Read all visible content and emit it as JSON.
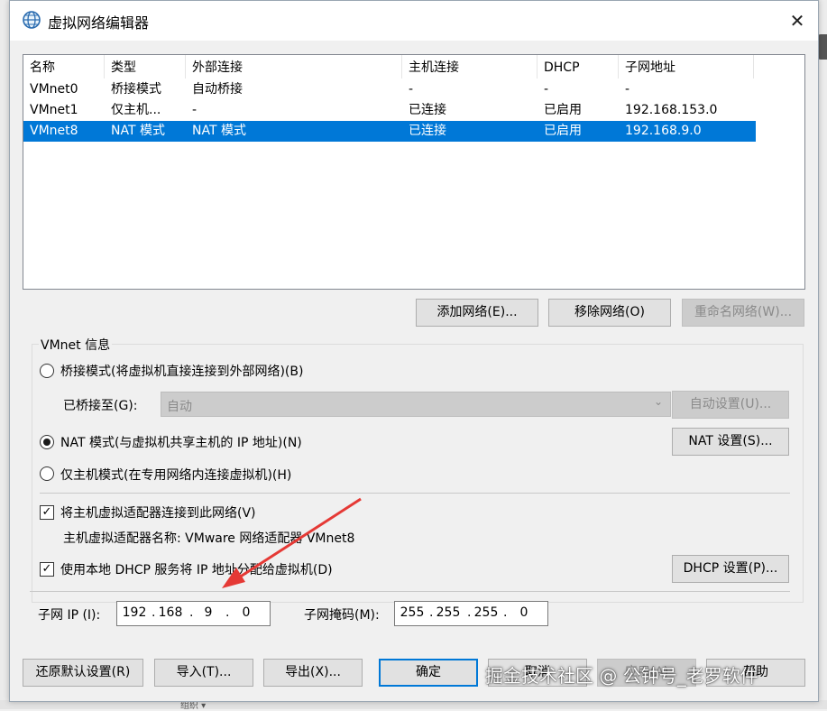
{
  "window": {
    "title": "虚拟网络编辑器",
    "close_glyph": "✕"
  },
  "table": {
    "columns": [
      "名称",
      "类型",
      "外部连接",
      "主机连接",
      "DHCP",
      "子网地址"
    ],
    "rows": [
      [
        "VMnet0",
        "桥接模式",
        "自动桥接",
        "-",
        "-",
        "-"
      ],
      [
        "VMnet1",
        "仅主机...",
        "-",
        "已连接",
        "已启用",
        "192.168.153.0"
      ],
      [
        "VMnet8",
        "NAT 模式",
        "NAT 模式",
        "已连接",
        "已启用",
        "192.168.9.0"
      ]
    ],
    "selected_row": 2
  },
  "list_buttons": {
    "add": "添加网络(E)...",
    "remove": "移除网络(O)",
    "rename": "重命名网络(W)..."
  },
  "info": {
    "group_label": "VMnet 信息",
    "bridged_radio": "桥接模式(将虚拟机直接连接到外部网络)(B)",
    "bridged_to_label": "已桥接至(G):",
    "bridged_to_value": "自动",
    "auto_settings": "自动设置(U)...",
    "nat_radio": "NAT 模式(与虚拟机共享主机的 IP 地址)(N)",
    "nat_settings": "NAT 设置(S)...",
    "hostonly_radio": "仅主机模式(在专用网络内连接虚拟机)(H)",
    "connect_adapter": "将主机虚拟适配器连接到此网络(V)",
    "adapter_name": "主机虚拟适配器名称: VMware 网络适配器 VMnet8",
    "use_dhcp": "使用本地 DHCP 服务将 IP 地址分配给虚拟机(D)",
    "dhcp_settings": "DHCP 设置(P)...",
    "subnet_ip_label": "子网 IP (I):",
    "subnet_ip": [
      "192",
      "168",
      "9",
      "0"
    ],
    "subnet_mask_label": "子网掩码(M):",
    "subnet_mask": [
      "255",
      "255",
      "255",
      "0"
    ]
  },
  "footer": {
    "restore": "还原默认设置(R)",
    "import": "导入(T)...",
    "export": "导出(X)...",
    "ok": "确定",
    "cancel": "取消",
    "apply": "应用(A)",
    "help": "帮助"
  },
  "watermark": "掘金技术社区 @ 公钟号_老罗软件",
  "background": {
    "taskbar_text": "组织 ▾"
  },
  "colors": {
    "selection": "#0078d7",
    "annotation_arrow": "#e53935"
  }
}
